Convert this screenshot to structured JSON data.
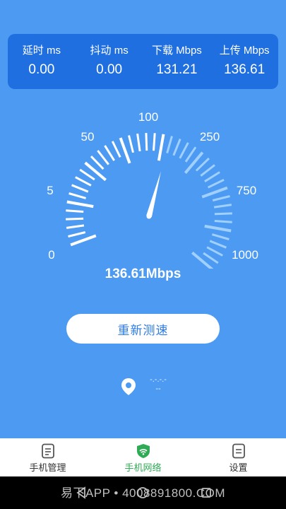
{
  "stats": [
    {
      "label": "延时 ms",
      "value": "0.00"
    },
    {
      "label": "抖动 ms",
      "value": "0.00"
    },
    {
      "label": "下载 Mbps",
      "value": "131.21"
    },
    {
      "label": "上传 Mbps",
      "value": "136.61"
    }
  ],
  "gauge": {
    "scale_labels": [
      "0",
      "5",
      "50",
      "100",
      "250",
      "750",
      "1000"
    ],
    "reading": "136.61Mbps",
    "needle_fraction": 0.52
  },
  "actions": {
    "retest_label": "重新测速"
  },
  "location": {
    "line1": "-.-.-.-",
    "line2": "--"
  },
  "tabs": [
    {
      "label": "手机管理",
      "active": false
    },
    {
      "label": "手机网络",
      "active": true
    },
    {
      "label": "设置",
      "active": false
    }
  ],
  "watermark": "易下APP • 4008891800.COM",
  "colors": {
    "background": "#4d9af2",
    "card": "#1f6fe0",
    "accent_green": "#2eab54",
    "button_text": "#2c7be5",
    "gauge_highlight": "#9fd0ff"
  }
}
